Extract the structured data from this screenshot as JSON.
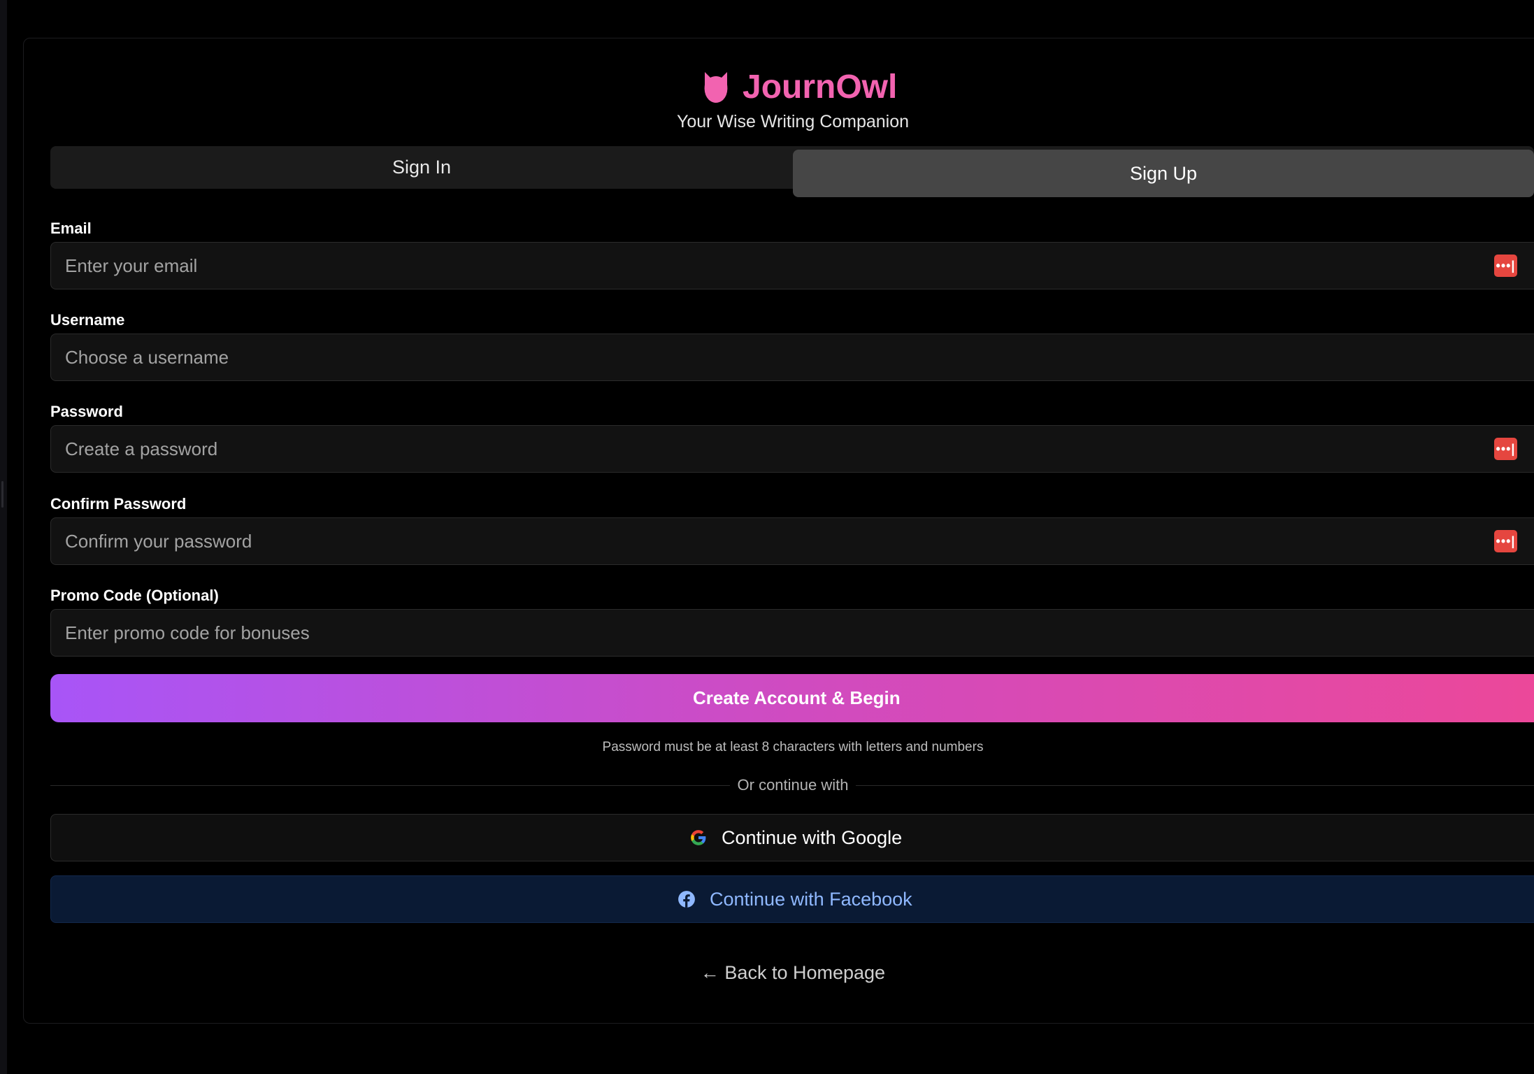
{
  "brand": {
    "name": "JournOwl",
    "tagline": "Your Wise Writing Companion",
    "accent_color": "#f263b0",
    "icon": "owl-icon"
  },
  "tabs": [
    {
      "label": "Sign In",
      "active": false
    },
    {
      "label": "Sign Up",
      "active": true
    }
  ],
  "form": {
    "email": {
      "label": "Email",
      "placeholder": "Enter your email",
      "value": "",
      "badge_icon": "password-manager-icon"
    },
    "username": {
      "label": "Username",
      "placeholder": "Choose a username",
      "value": ""
    },
    "password": {
      "label": "Password",
      "placeholder": "Create a password",
      "value": "",
      "badge_icon": "password-manager-icon"
    },
    "confirm_password": {
      "label": "Confirm Password",
      "placeholder": "Confirm your password",
      "value": "",
      "badge_icon": "password-manager-icon"
    },
    "promo": {
      "label": "Promo Code (Optional)",
      "placeholder": "Enter promo code for bonuses",
      "value": ""
    },
    "badge_glyph": "•••|",
    "badge_color": "#e5463f"
  },
  "submit": {
    "label": "Create Account & Begin",
    "gradient_start": "#a855f7",
    "gradient_end": "#ec4899"
  },
  "hint": "Password must be at least 8 characters with letters and numbers",
  "divider_text": "Or continue with",
  "social": {
    "google": {
      "label": "Continue with Google",
      "icon": "google-icon"
    },
    "facebook": {
      "label": "Continue with Facebook",
      "icon": "facebook-icon",
      "color": "#8fb8ff"
    }
  },
  "back_link": "← Back to Homepage"
}
